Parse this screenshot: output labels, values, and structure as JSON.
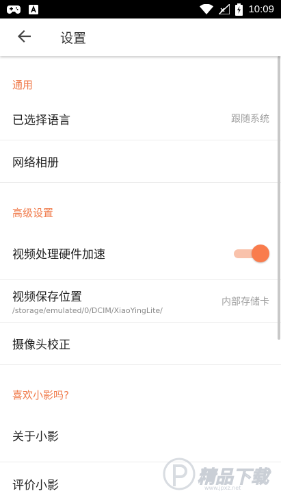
{
  "status_bar": {
    "time": "10:09",
    "icons_left": [
      "gamepad-icon",
      "notification-a-icon"
    ],
    "icons_right": [
      "wifi-icon",
      "signal-icon",
      "battery-charging-icon"
    ]
  },
  "toolbar": {
    "back_icon": "arrow-back-icon",
    "title": "设置"
  },
  "sections": [
    {
      "header": "通用",
      "items": [
        {
          "title": "已选择语言",
          "value": "跟随系统"
        },
        {
          "title": "网络相册"
        }
      ]
    },
    {
      "header": "高级设置",
      "items": [
        {
          "title": "视频处理硬件加速",
          "toggle_on": true
        },
        {
          "title": "视频保存位置",
          "subtitle": "/storage/emulated/0/DCIM/XiaoYingLite/",
          "value": "内部存储卡"
        },
        {
          "title": "摄像头校正"
        }
      ]
    },
    {
      "header": "喜欢小影吗?",
      "items": [
        {
          "title": "关于小影"
        },
        {
          "title": "评价小影"
        }
      ]
    }
  ],
  "watermark": {
    "text": "精品下载",
    "url": "www.jpxz.net"
  },
  "colors": {
    "accent": "#f07a4a",
    "toggle_thumb": "#f97c4d",
    "toggle_track": "#f9c2ab"
  }
}
